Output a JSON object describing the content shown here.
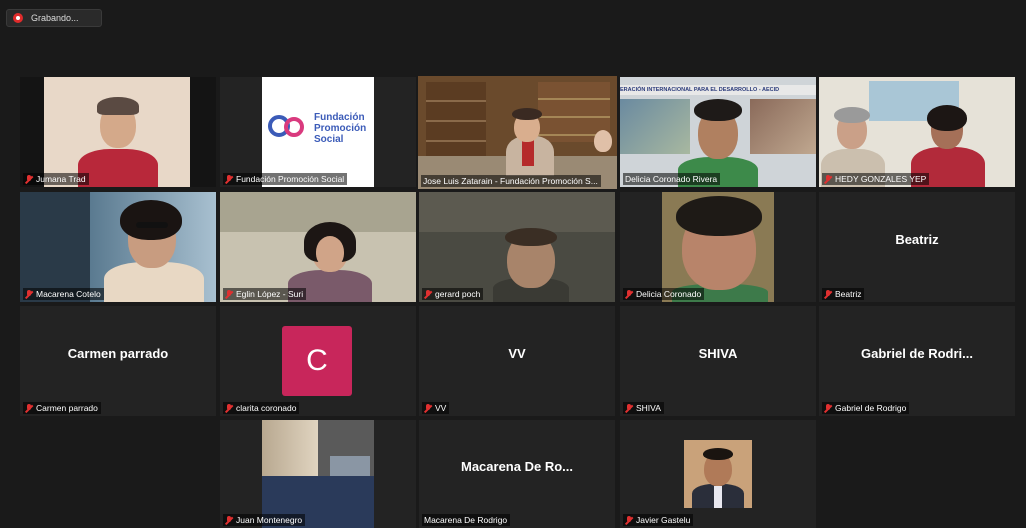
{
  "recording": {
    "label": "Grabando..."
  },
  "participants": [
    {
      "name": "Jumana Trad"
    },
    {
      "name": "Fundación Promoción Social",
      "logo_text": [
        "Fundación",
        "Promoción",
        "Social"
      ]
    },
    {
      "name": "Jose Luis Zatarain - Fundación Promoción S...",
      "active": true
    },
    {
      "name": "Delicia Coronado Rivera",
      "banner_text": "ERACIÓN INTERNACIONAL PARA EL DESARROLLO - AECID"
    },
    {
      "name": "HEDY GONZALES YEP"
    },
    {
      "name": "Macarena Cotelo"
    },
    {
      "name": "Eglin López - Suri"
    },
    {
      "name": "gerard poch"
    },
    {
      "name": "Delicia Coronado"
    },
    {
      "name": "Beatriz",
      "display": "Beatriz"
    },
    {
      "name": "Carmen parrado",
      "display": "Carmen parrado"
    },
    {
      "name": "clarita coronado",
      "avatar_letter": "C"
    },
    {
      "name": "VV",
      "display": "VV"
    },
    {
      "name": "SHIVA",
      "display": "SHIVA"
    },
    {
      "name": "Gabriel de Rodrigo",
      "display": "Gabriel de Rodri..."
    },
    {
      "name": "Juan Montenegro"
    },
    {
      "name": "Macarena De Rodrigo",
      "display": "Macarena De Ro..."
    },
    {
      "name": "Javier Gastelu"
    }
  ],
  "colors": {
    "active_border": "#c8d33c",
    "avatar_c": "#c8265b",
    "mute": "#e03030"
  }
}
